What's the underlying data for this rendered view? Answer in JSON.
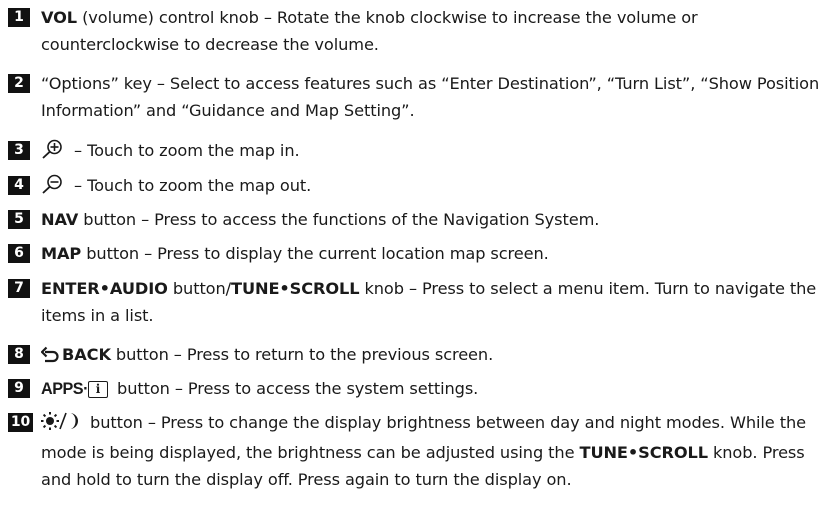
{
  "items": [
    {
      "num": "1",
      "key": "VOL",
      "text": " (volume) control knob – Rotate the knob clockwise to increase the volume or counterclockwise to decrease the volume."
    },
    {
      "num": "2",
      "text": "“Options” key – Select to access features such as “Enter Destination”, “Turn List”, “Show Position Information” and “Guidance and Map Setting”."
    },
    {
      "num": "3",
      "icon": "zoom-in-icon",
      "text": " – Touch to zoom the map in."
    },
    {
      "num": "4",
      "icon": "zoom-out-icon",
      "text": " – Touch to zoom the map out."
    },
    {
      "num": "5",
      "key": "NAV",
      "text": " button – Press to access the functions of the Navigation System."
    },
    {
      "num": "6",
      "key": "MAP",
      "text": " button – Press to display the current location map screen."
    },
    {
      "num": "7",
      "key": "ENTER•AUDIO",
      "mid": " button/",
      "key2": "TUNE•SCROLL",
      "text": " knob – Press to select a menu item. Turn to navigate the items in a list."
    },
    {
      "num": "8",
      "icon": "back-arrow-icon",
      "key": "BACK",
      "text": " button – Press to return to the previous screen."
    },
    {
      "num": "9",
      "key": "APPS·",
      "icon": "info-box-icon",
      "icon_text": "i",
      "text": " button – Press to access the system settings."
    },
    {
      "num": "10",
      "icon": "day-night-icon",
      "text": " button – Press to change the display brightness between day and night modes. While the mode is being displayed, the brightness can be adjusted using the ",
      "key": "TUNE•SCROLL",
      "text2": " knob. Press and hold to turn the display off. Press again to turn the display on."
    }
  ]
}
